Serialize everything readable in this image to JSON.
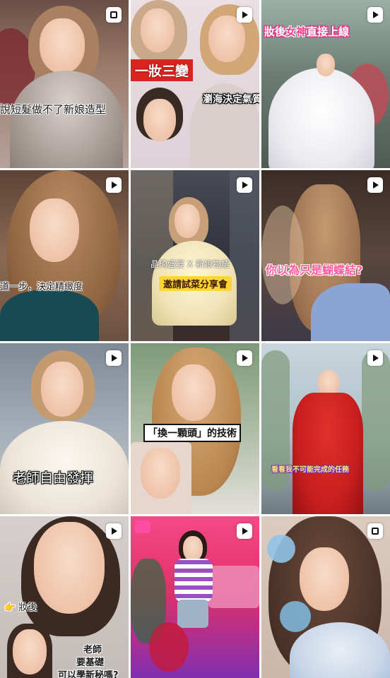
{
  "feed": {
    "tiles": [
      {
        "captions": [
          "說短髮做不了新娘造型"
        ],
        "badge": "multi",
        "colors": {
          "bg": "#8a6a5c",
          "accent": "#c9b9b0"
        }
      },
      {
        "captions": [
          "一妝三變",
          "瀏海決定氣質"
        ],
        "badge": "video",
        "colors": {
          "bg": "#e9e3e6",
          "accent": "#d9b08c"
        }
      },
      {
        "captions": [
          "妝後",
          "女神",
          "直接上線"
        ],
        "badge": "video",
        "colors": {
          "bg": "#5f6b66",
          "accent": "#f3f0f4"
        }
      },
      {
        "captions": [
          "道一步，決定精緻度"
        ],
        "badge": "video",
        "colors": {
          "bg": "#7a5a48",
          "accent": "#1d5a5e"
        }
      },
      {
        "captions": [
          "晶碕盛宴 X 新娘物語",
          "邀請試菜分享會"
        ],
        "badge": "video",
        "colors": {
          "bg": "#2f3440",
          "accent": "#f1e3b6"
        }
      },
      {
        "captions": [
          "你以為只是蝴蝶結?"
        ],
        "badge": "video",
        "colors": {
          "bg": "#4a3a33",
          "accent": "#9ab0d8"
        }
      },
      {
        "captions": [
          "老師自由發揮"
        ],
        "badge": "video",
        "colors": {
          "bg": "#8d9aa8",
          "accent": "#efe9df"
        }
      },
      {
        "captions": [
          "「換一顆頭」的技術"
        ],
        "badge": "video",
        "colors": {
          "bg": "#6e8a6b",
          "accent": "#c89a6a"
        }
      },
      {
        "captions": [
          "看看我不可能完成的任務"
        ],
        "badge": "video",
        "colors": {
          "bg": "#b7c7cf",
          "accent": "#c81e1e"
        }
      },
      {
        "captions": [
          "妝後",
          "老師",
          "要基礎",
          "可以學新秘嗎?"
        ],
        "badge": "video",
        "colors": {
          "bg": "#c8c2bf",
          "accent": "#3a2a22"
        }
      },
      {
        "captions": [],
        "badge": "video",
        "colors": {
          "bg": "#e0306a",
          "accent": "#7a2fb5"
        }
      },
      {
        "captions": [],
        "badge": "multi",
        "colors": {
          "bg": "#d8c7bc",
          "accent": "#7eb6d9"
        }
      }
    ]
  },
  "icons": {
    "video": "play-reel-icon",
    "multi": "carousel-icon"
  }
}
